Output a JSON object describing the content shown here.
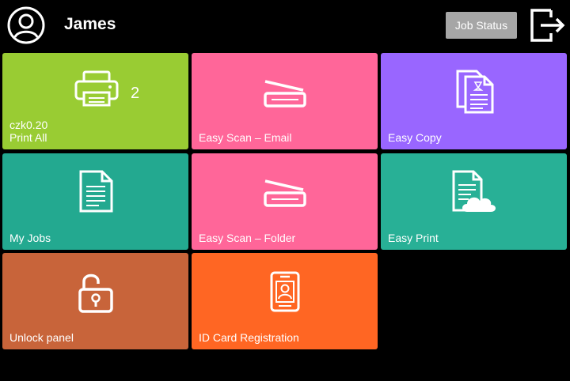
{
  "header": {
    "user_name": "James",
    "job_status_label": "Job Status",
    "icons": {
      "avatar": "user-avatar-icon",
      "logout": "logout-icon"
    }
  },
  "tiles": [
    {
      "label": "Print All",
      "price": "czk0.20",
      "count": "2",
      "icon": "printer-icon",
      "color": "#99cc33"
    },
    {
      "label": "Easy Scan – Email",
      "icon": "scanner-icon",
      "color": "#ff6699"
    },
    {
      "label": "Easy Copy",
      "icon": "copy-documents-icon",
      "color": "#9966ff"
    },
    {
      "label": "My Jobs",
      "icon": "document-icon",
      "color": "#23a990"
    },
    {
      "label": "Easy Scan – Folder",
      "icon": "scanner-icon",
      "color": "#ff6699"
    },
    {
      "label": "Easy Print",
      "icon": "document-cloud-icon",
      "color": "#28b096"
    },
    {
      "label": "Unlock panel",
      "icon": "unlocked-padlock-icon",
      "color": "#c8643a"
    },
    {
      "label": "ID Card Registration",
      "icon": "id-card-icon",
      "color": "#ff6623"
    }
  ]
}
